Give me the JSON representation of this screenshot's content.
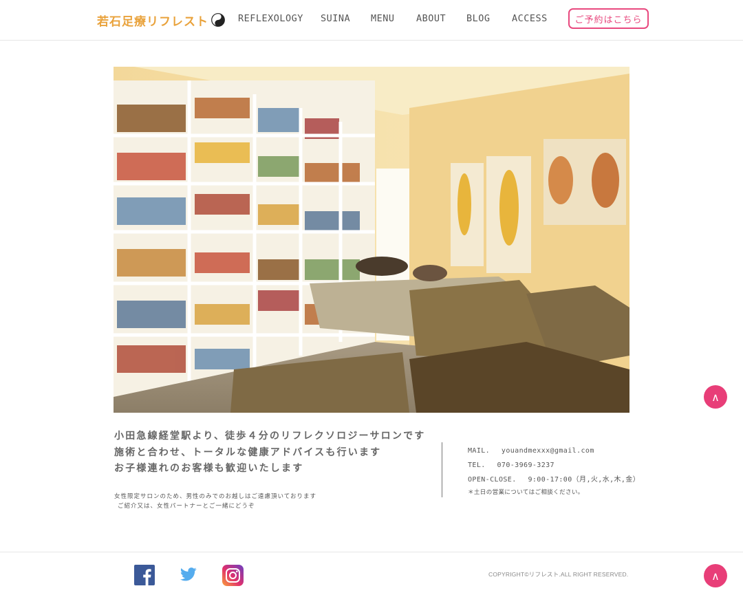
{
  "header": {
    "logo_text": "若石足療リフレスト",
    "nav": [
      "REFLEXOLOGY",
      "SUINA",
      "MENU",
      "ABOUT",
      "BLOG",
      "ACCESS"
    ],
    "reserve_label": "ご予約はこちら"
  },
  "intro": {
    "lines": [
      "小田急線経堂駅より、徒歩４分のリフレクソロジーサロンです",
      "施術と合わせ、トータルな健康アドバイスも行います",
      "お子様連れのお客様も歓迎いたします"
    ],
    "notes": [
      "女性限定サロンのため、男性のみでのお越しはご遠慮頂いております",
      "ご紹介又は、女性パートナーとご一緒にどうぞ"
    ]
  },
  "contact": {
    "mail": "MAIL.　 youandmexxx@gmail.com",
    "tel": "TEL.　 070-3969-3237",
    "hours": "OPEN-CLOSE.　 9:00-17:00（月,火,水,木,金）",
    "note": "＊土日の営業についてはご相談ください。"
  },
  "footer": {
    "copyright": "COPYRIGHT©リフレスト.ALL RIGHT RESERVED."
  },
  "scroll_top_label": "∧",
  "colors": {
    "accent_pink": "#e83e78",
    "logo_orange": "#e9a23b"
  },
  "icons": [
    "yin-yang-icon",
    "facebook-icon",
    "twitter-icon",
    "instagram-icon",
    "chevron-up-icon"
  ]
}
